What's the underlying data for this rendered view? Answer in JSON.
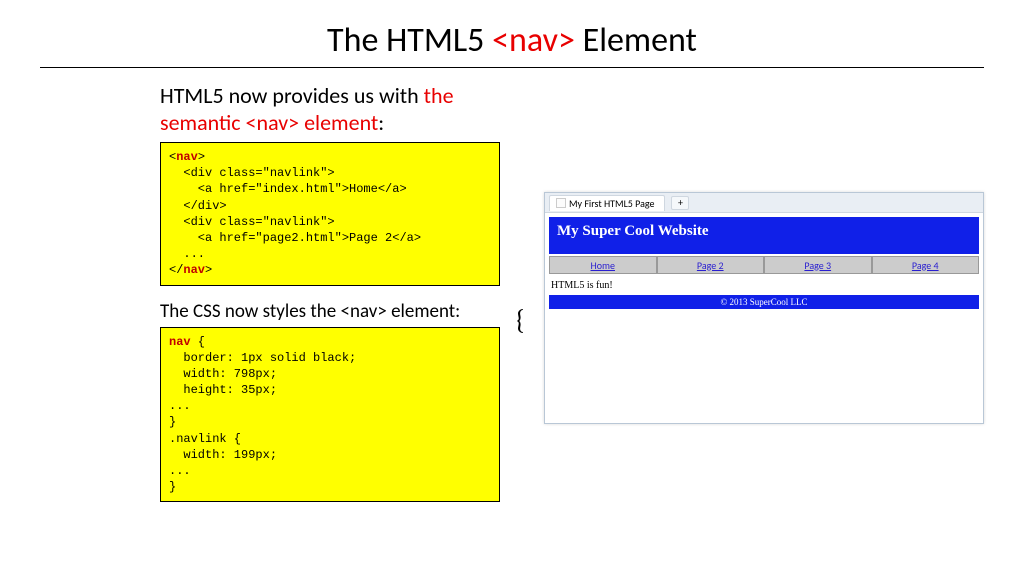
{
  "title": {
    "pre": "The HTML5 ",
    "highlight": "<nav>",
    "post": " Element"
  },
  "intro": {
    "black": "HTML5 now provides us with ",
    "red": "the semantic <nav> element",
    "tail": ":"
  },
  "code_html": {
    "l1a": "<",
    "l1b": "nav",
    "l1c": ">",
    "l2": "  <div class=\"navlink\">",
    "l3": "    <a href=\"index.html\">Home</a>",
    "l4": "  </div>",
    "l5": "  <div class=\"navlink\">",
    "l6": "    <a href=\"page2.html\">Page 2</a>",
    "l7": "  ...",
    "l8a": "</",
    "l8b": "nav",
    "l8c": ">"
  },
  "subhead": "The CSS now styles the <nav> element:",
  "code_css": {
    "l1a": "nav",
    "l1b": " {",
    "l2": "  border: 1px solid black;",
    "l3": "  width: 798px;",
    "l4": "  height: 35px;",
    "l5": "...",
    "l6": "}",
    "l7": ".navlink {",
    "l8": "  width: 199px;",
    "l9": "...",
    "l10": "}"
  },
  "brace": "{",
  "browser": {
    "tab_title": "My First HTML5 Page",
    "plus": "+",
    "site_title": "My Super Cool Website",
    "nav": [
      "Home",
      "Page 2",
      "Page 3",
      "Page 4"
    ],
    "body_text": "HTML5 is fun!",
    "footer": "© 2013 SuperCool LLC"
  }
}
